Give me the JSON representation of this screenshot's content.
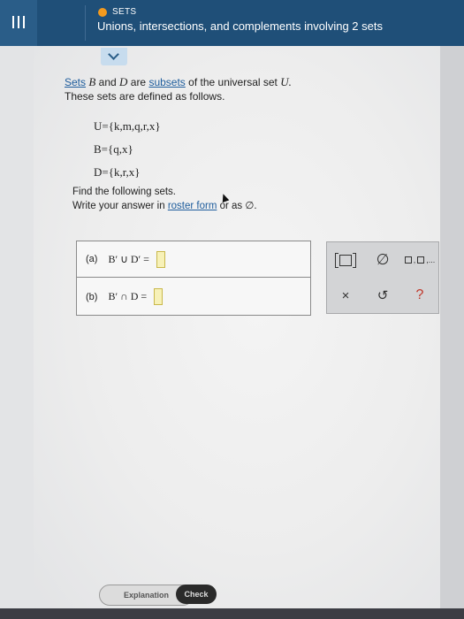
{
  "header": {
    "topic": "SETS",
    "title": "Unions, intersections, and complements involving 2 sets",
    "topic_dot_color": "#f39a1e",
    "bar_color": "#1f4f78"
  },
  "problem": {
    "intro_sets_word": "Sets",
    "intro_B": "B",
    "intro_and": "and",
    "intro_D": "D",
    "intro_are": "are",
    "intro_subsets_link": "subsets",
    "intro_rest": "of the universal set",
    "intro_U": "U.",
    "intro_line2": "These sets are defined as follows.",
    "set_U": "U={k,m,q,r,x}",
    "set_B": "B={q,x}",
    "set_D": "D={k,r,x}",
    "instruction_line1": "Find the following sets.",
    "instruction_line2_prefix": "Write your answer in",
    "instruction_roster_link": "roster form",
    "instruction_line2_suffix": "or as ∅."
  },
  "answers": [
    {
      "label": "(a)",
      "expression": "B′ ∪ D′ =",
      "value": ""
    },
    {
      "label": "(b)",
      "expression": "B′ ∩ D =",
      "value": ""
    }
  ],
  "palette": {
    "braces_icon": "set-braces-icon",
    "empty_set": "∅",
    "more_icon": "□,□,...",
    "clear": "×",
    "undo": "↺",
    "help": "?"
  },
  "buttons": {
    "explanation": "Explanation",
    "check": "Check"
  }
}
